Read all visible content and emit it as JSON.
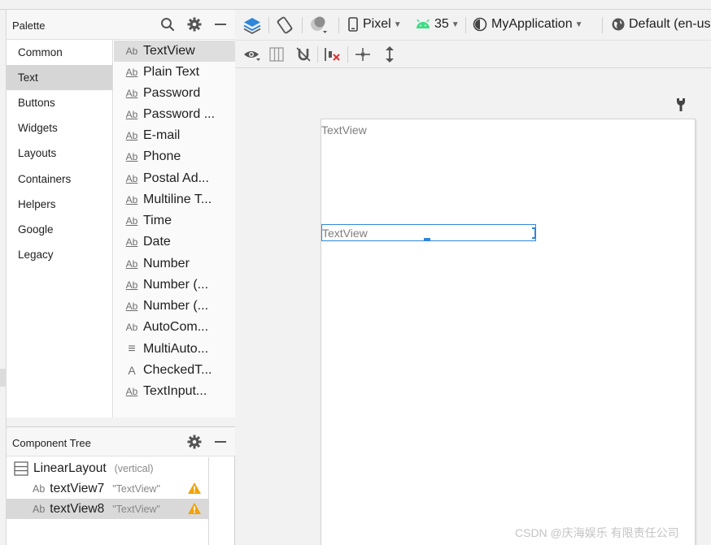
{
  "palette": {
    "title": "Palette",
    "categories": [
      "Common",
      "Text",
      "Buttons",
      "Widgets",
      "Layouts",
      "Containers",
      "Helpers",
      "Google",
      "Legacy"
    ],
    "selected_category": "Text",
    "items": [
      {
        "icon": "Ab",
        "label": "TextView"
      },
      {
        "icon": "Ab",
        "label": "Plain Text"
      },
      {
        "icon": "Ab",
        "label": "Password"
      },
      {
        "icon": "Ab",
        "label": "Password ..."
      },
      {
        "icon": "Ab",
        "label": "E-mail"
      },
      {
        "icon": "Ab",
        "label": "Phone"
      },
      {
        "icon": "Ab",
        "label": "Postal Ad..."
      },
      {
        "icon": "Ab",
        "label": "Multiline T..."
      },
      {
        "icon": "Ab",
        "label": "Time"
      },
      {
        "icon": "Ab",
        "label": "Date"
      },
      {
        "icon": "Ab",
        "label": "Number"
      },
      {
        "icon": "Ab",
        "label": "Number (..."
      },
      {
        "icon": "Ab",
        "label": "Number (..."
      },
      {
        "icon": "Ab",
        "label": "AutoCom..."
      },
      {
        "icon": "≡",
        "label": "MultiAuto..."
      },
      {
        "icon": "A",
        "label": "CheckedT..."
      },
      {
        "icon": "Ab",
        "label": "TextInput..."
      }
    ]
  },
  "component_tree": {
    "title": "Component Tree",
    "root": {
      "name": "LinearLayout",
      "sub": "(vertical)"
    },
    "children": [
      {
        "icon": "Ab",
        "name": "textView7",
        "text": "\"TextView\""
      },
      {
        "icon": "Ab",
        "name": "textView8",
        "text": "\"TextView\""
      }
    ]
  },
  "toolbar": {
    "device": "Pixel",
    "api_level": "35",
    "theme": "MyApplication",
    "locale": "Default (en-us)"
  },
  "canvas": {
    "textview1": "TextView",
    "textview2": "TextView"
  },
  "watermark": "CSDN @庆海娱乐 有限责任公司",
  "colors": {
    "accent": "#2f86d9",
    "android_green": "#3ddc84",
    "warning": "#f0a30a"
  }
}
